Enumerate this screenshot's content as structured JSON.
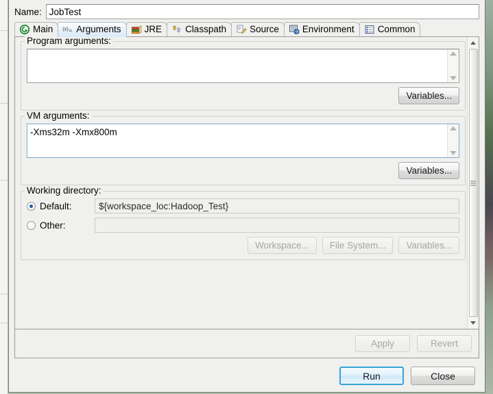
{
  "dialog": {
    "name_label": "Name:",
    "name_value": "JobTest",
    "name_placeholder": "Name"
  },
  "tabs": [
    {
      "id": "main",
      "label": "Main",
      "icon": "green-circle-g-icon",
      "selected": false
    },
    {
      "id": "arguments",
      "label": "Arguments",
      "icon": "variable-xy-icon",
      "selected": true
    },
    {
      "id": "jre",
      "label": "JRE",
      "icon": "book-stack-icon",
      "selected": false
    },
    {
      "id": "classpath",
      "label": "Classpath",
      "icon": "classpath-jars-icon",
      "selected": false
    },
    {
      "id": "source",
      "label": "Source",
      "icon": "source-pencil-icon",
      "selected": false
    },
    {
      "id": "environment",
      "label": "Environment",
      "icon": "environment-icon",
      "selected": false
    },
    {
      "id": "common",
      "label": "Common",
      "icon": "common-list-icon",
      "selected": false
    }
  ],
  "arguments_tab": {
    "program_args": {
      "group_label": "Program arguments:",
      "value": "",
      "variables_button": "Variables..."
    },
    "vm_args": {
      "group_label": "VM arguments:",
      "value": "-Xms32m -Xmx800m",
      "focused": true,
      "variables_button": "Variables..."
    },
    "working_directory": {
      "group_label": "Working directory:",
      "default_label": "Default:",
      "default_selected": true,
      "default_value": "${workspace_loc:Hadoop_Test}",
      "other_label": "Other:",
      "other_selected": false,
      "other_value": "",
      "workspace_button": "Workspace...",
      "filesystem_button": "File System...",
      "variables_button": "Variables...",
      "buttons_enabled": false
    }
  },
  "footer": {
    "apply_button": "Apply",
    "apply_enabled": false,
    "revert_button": "Revert",
    "revert_enabled": false,
    "run_button": "Run",
    "close_button": "Close"
  },
  "colors": {
    "dialog_bg": "#f0f0ee",
    "selected_tab": "#dbe9f7",
    "default_button_border": "#35a3d6",
    "radio_dot": "#1b5fa8",
    "field_border_focus": "#7fa9cd"
  }
}
